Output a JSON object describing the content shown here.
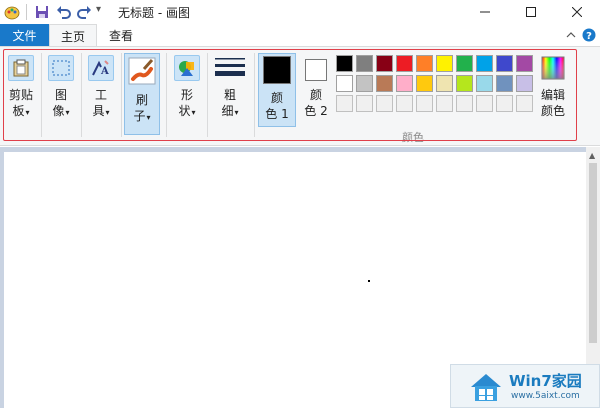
{
  "window": {
    "title": "无标题 - 画图",
    "qat_dropdown": "▾"
  },
  "menu": {
    "file_tab": "文件",
    "tabs": [
      {
        "label": "主页",
        "active": true
      },
      {
        "label": "查看",
        "active": false
      }
    ]
  },
  "ribbon": {
    "clipboard": {
      "label_line1": "剪贴",
      "label_line2": "板",
      "icon": "clipboard-icon"
    },
    "image": {
      "label_line1": "图",
      "label_line2": "像",
      "icon": "select-icon"
    },
    "tools": {
      "label_line1": "工",
      "label_line2": "具",
      "icon": "tools-icon"
    },
    "brushes": {
      "label_line1": "刷",
      "label_line2": "子",
      "icon": "brush-icon"
    },
    "shapes": {
      "label_line1": "形",
      "label_line2": "状",
      "icon": "shapes-icon"
    },
    "size": {
      "label_line1": "粗",
      "label_line2": "细",
      "icon": "line-width-icon"
    },
    "color1": {
      "label_line1": "颜",
      "label_line2": "色 1",
      "value": "#000000"
    },
    "color2": {
      "label_line1": "颜",
      "label_line2": "色 2",
      "value": "#ffffff"
    },
    "edit_colors": {
      "label_line1": "编辑",
      "label_line2": "颜色",
      "icon": "color-spectrum-icon"
    },
    "colors_group_label": "颜色",
    "palette": {
      "row1": [
        "#000000",
        "#7f7f7f",
        "#880015",
        "#ed1c24",
        "#ff7f27",
        "#fff200",
        "#22b14c",
        "#00a2e8",
        "#3f48cc",
        "#a349a4"
      ],
      "row2": [
        "#ffffff",
        "#c3c3c3",
        "#b97a57",
        "#ffaec9",
        "#ffc90e",
        "#efe4b0",
        "#b5e61d",
        "#99d9ea",
        "#7092be",
        "#c8bfe7"
      ],
      "row3": [
        "#f0f0f0",
        "#f0f0f0",
        "#f0f0f0",
        "#f0f0f0",
        "#f0f0f0",
        "#f0f0f0",
        "#f0f0f0",
        "#f0f0f0",
        "#f0f0f0",
        "#f0f0f0"
      ]
    }
  },
  "watermark": {
    "title": "Win7家园",
    "url": "www.5aixt.com"
  }
}
